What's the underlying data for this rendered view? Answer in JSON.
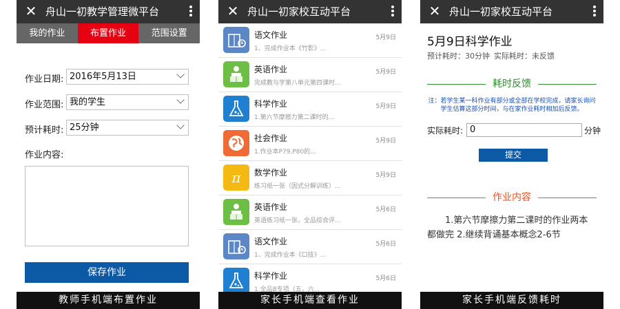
{
  "phone1": {
    "app_title": "舟山一初教学管理微平台",
    "tabs": [
      {
        "label": "我的作业"
      },
      {
        "label": "布置作业"
      },
      {
        "label": "范围设置"
      }
    ],
    "active_tab": 1,
    "fields": {
      "date_label": "作业日期:",
      "date_value": "2016年5月13日",
      "scope_label": "作业范围:",
      "scope_value": "我的学生",
      "time_label": "预计耗时:",
      "time_value": "25分钟",
      "content_label": "作业内容:"
    },
    "save_label": "保存作业",
    "caption": "教师手机端布置作业"
  },
  "phone2": {
    "app_title": "舟山一初家校互动平台",
    "items": [
      {
        "title": "语文作业",
        "sub": "1、完成作业本《竹影》...",
        "date": "5月9日",
        "icon": "book-clock-icon",
        "color": "#5b87c7"
      },
      {
        "title": "英语作业",
        "sub": "完成教与学第八单元第四课时...",
        "date": "5月9日",
        "icon": "reading-person-icon",
        "color": "#6cbe45"
      },
      {
        "title": "科学作业",
        "sub": "1.第六节摩擦力第二课时的...",
        "date": "5月9日",
        "icon": "flask-icon",
        "color": "#1f7fd0"
      },
      {
        "title": "社会作业",
        "sub": "1.作业本P79,P80的...",
        "date": "5月9日",
        "icon": "globe-icon",
        "color": "#f06a35"
      },
      {
        "title": "数学作业",
        "sub": "练习纸一张（因式分解训练）...",
        "date": "5月9日",
        "icon": "pi-icon",
        "color": "#f5b914"
      },
      {
        "title": "英语作业",
        "sub": "英语练习纸一张，全品综合评...",
        "date": "5月6日",
        "icon": "reading-person-icon",
        "color": "#6cbe45"
      },
      {
        "title": "语文作业",
        "sub": "1、完成作业本《口技》...",
        "date": "5月6日",
        "icon": "book-clock-icon",
        "color": "#5b87c7"
      },
      {
        "title": "科学作业",
        "sub": "1.全品B专项（五，六...",
        "date": "5月6日",
        "icon": "flask-icon",
        "color": "#1f7fd0"
      }
    ],
    "caption": "家长手机端查看作业"
  },
  "phone3": {
    "app_title": "舟山一初家校互动平台",
    "page_title": "5月9日科学作业",
    "estimated": "预计耗时：30分钟",
    "actual_status": "实际耗时：未反馈",
    "feedback_heading": "耗时反馈",
    "note": "注：若学生某一科作业有部分或全部在学校完成，请家长询问学生估算这部分时间，与在家作业耗时相加后反馈。",
    "actual_label": "实际耗时:",
    "actual_value": "0",
    "unit": "分钟",
    "submit_label": "提交",
    "content_heading": "作业内容",
    "content_text": "1.第六节摩擦力第二课时的作业两本都做完 2.继续背诵基本概念2-6节",
    "caption": "家长手机端反馈耗时",
    "colors": {
      "feedback": "#2e8b2e",
      "content": "#e8531e"
    }
  }
}
